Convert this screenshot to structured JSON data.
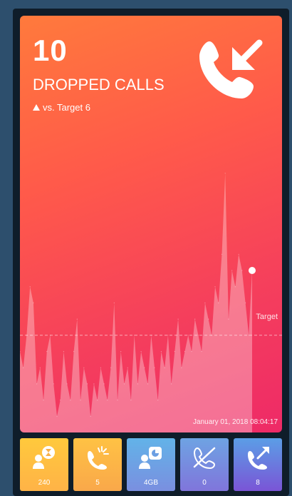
{
  "metric": {
    "value": "10",
    "label": "DROPPED CALLS",
    "target_text": "vs. Target 6",
    "target_marker_label": "Target",
    "timestamp": "January 01, 2018 08:04:17",
    "icon": "phone-incoming-icon"
  },
  "chart_data": {
    "type": "area",
    "title": "",
    "xlabel": "",
    "ylabel": "",
    "ylim": [
      0,
      20
    ],
    "target": 6,
    "current": 10,
    "series": [
      {
        "name": "",
        "values": [
          5,
          4,
          6,
          9,
          8,
          3,
          4,
          2,
          5,
          6,
          3,
          1,
          2,
          5,
          3,
          2,
          5,
          7,
          2,
          4,
          3,
          1,
          3,
          2,
          4,
          3,
          2,
          4,
          8,
          2,
          5,
          3,
          4,
          2,
          6,
          3,
          5,
          4,
          3,
          6,
          4,
          2,
          5,
          4,
          6,
          3,
          5,
          7,
          4,
          5,
          6,
          5,
          7,
          6,
          5,
          8,
          7,
          6,
          9,
          8,
          11,
          16,
          7,
          10,
          9,
          11,
          10,
          8,
          6,
          10
        ]
      }
    ]
  },
  "tiles": [
    {
      "value": "240",
      "icon": "hourglass-person-icon",
      "color_top": "#ffc93c",
      "color_bottom": "#ffb347"
    },
    {
      "value": "5",
      "icon": "phone-ringing-icon",
      "color_top": "#ffc244",
      "color_bottom": "#f9a84a"
    },
    {
      "value": "4GB",
      "icon": "data-usage-icon",
      "color_top": "#62b3e8",
      "color_bottom": "#7a8fe0"
    },
    {
      "value": "0",
      "icon": "phone-off-icon",
      "color_top": "#6ea3e3",
      "color_bottom": "#8075db"
    },
    {
      "value": "8",
      "icon": "phone-outgoing-icon",
      "color_top": "#5b9ee6",
      "color_bottom": "#7a55d6"
    }
  ]
}
